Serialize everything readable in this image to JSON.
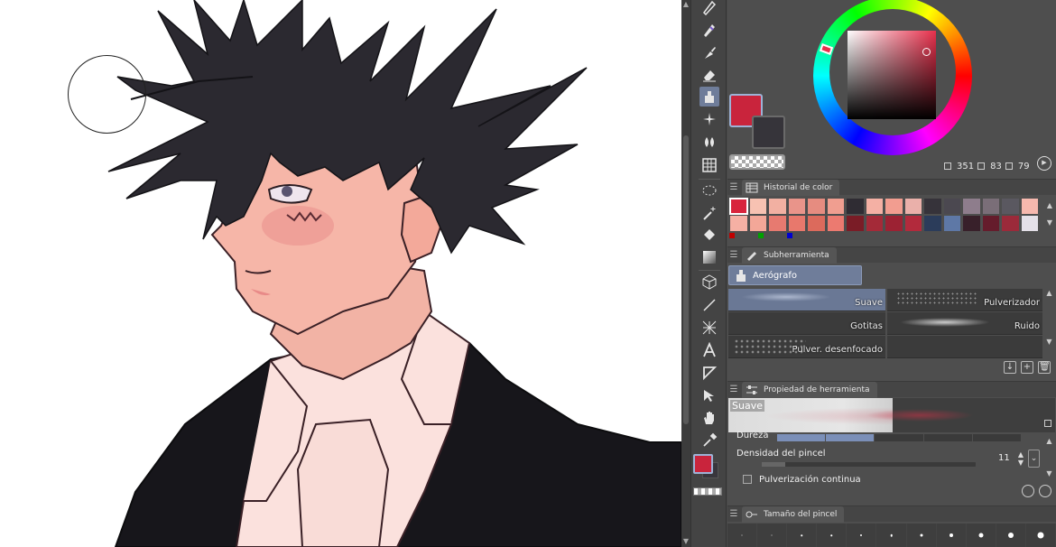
{
  "canvas": {
    "cursor_shape": "circle-brush-cursor"
  },
  "toolbar": {
    "tools": [
      {
        "name": "pen-tool-icon",
        "active": false
      },
      {
        "name": "pencil-tool-icon",
        "active": false
      },
      {
        "name": "brush-tool-icon",
        "active": false
      },
      {
        "name": "eraser-tool-icon",
        "active": false
      },
      {
        "name": "airbrush-tool-icon",
        "active": true
      },
      {
        "name": "decoration-tool-icon",
        "active": false
      },
      {
        "name": "blend-tool-icon",
        "active": false
      },
      {
        "name": "grid-tool-icon",
        "active": false
      },
      {
        "name": "selection-tool-icon",
        "active": false
      },
      {
        "name": "magic-wand-icon",
        "active": false
      },
      {
        "name": "fill-tool-icon",
        "active": false
      },
      {
        "name": "gradient-tool-icon",
        "active": false
      },
      {
        "name": "3d-object-icon",
        "active": false
      },
      {
        "name": "line-tool-icon",
        "active": false
      },
      {
        "name": "frame-tool-icon",
        "active": false
      },
      {
        "name": "text-tool-icon",
        "active": false
      },
      {
        "name": "figure-tool-icon",
        "active": false
      },
      {
        "name": "operation-tool-icon",
        "active": false
      },
      {
        "name": "hand-tool-icon",
        "active": false
      },
      {
        "name": "eyedropper-icon",
        "active": false
      }
    ]
  },
  "color_wheel": {
    "main_color": "#c9243c",
    "sub_color": "#36343a",
    "hue": "351",
    "saturation": "83",
    "value": "79"
  },
  "color_history": {
    "title": "Historial de color",
    "swatches_row1": [
      "#d8243c",
      "#f7c2b2",
      "#f2b0a2",
      "#e9948a",
      "#e68c80",
      "#f09e90",
      "#2f2c33",
      "#f4b0a4",
      "#f29d90",
      "#eab0aa",
      "#36333a",
      "#4b4850",
      "#8e7d8c",
      "#7a6e78",
      "#5a5860",
      "#f6b8ae",
      "#ffd8cf",
      "#b28ab8"
    ],
    "swatches_row2": [
      "#f5b0a4",
      "#f3a798",
      "#e77a70",
      "#e8786c",
      "#dc6a5c",
      "#ec7a70",
      "#7a1c26",
      "#a42a38",
      "#9c2233",
      "#b22a3c",
      "#2b3c5a",
      "#5e78a6",
      "#38202a",
      "#651c2c",
      "#9b2a3a",
      "#e4e0e8",
      "#1e1c22",
      "#3b3840"
    ],
    "dots": [
      "#c00000",
      "#00a000",
      "#0000d0"
    ]
  },
  "subtool": {
    "title": "Subherramienta",
    "active_group": "Aerógrafo",
    "brushes": [
      {
        "label": "Suave",
        "selected": true
      },
      {
        "label": "Pulverizador",
        "selected": false
      },
      {
        "label": "Gotitas",
        "selected": false
      },
      {
        "label": "Ruido",
        "selected": false
      },
      {
        "label": "Pulver. desenfocado",
        "selected": false
      }
    ]
  },
  "tool_property": {
    "title": "Propiedad de herramienta",
    "preview_label": "Suave",
    "dureza_label": "Dureza",
    "dureza_level": 2,
    "densidad_label": "Densidad del pincel",
    "densidad_value": "11",
    "pulverizacion_label": "Pulverización continua"
  },
  "brush_size": {
    "title": "Tamaño del pincel",
    "dot_sizes": [
      1,
      1,
      1.5,
      1.5,
      2,
      2.5,
      3,
      4,
      5,
      6,
      7
    ]
  }
}
